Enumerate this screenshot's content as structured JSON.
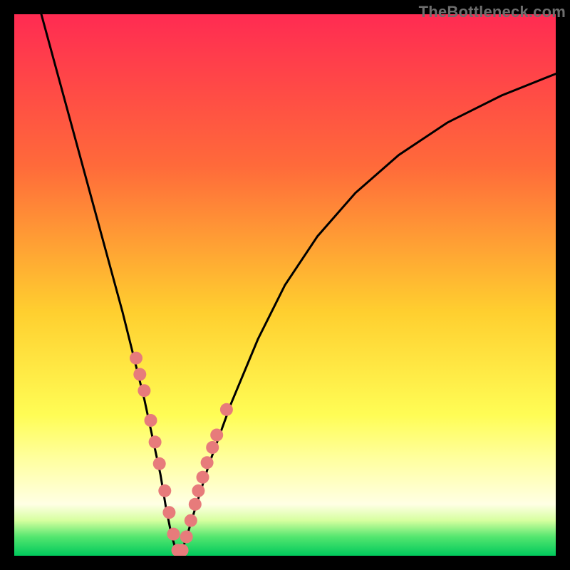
{
  "watermark": "TheBottleneck.com",
  "colors": {
    "bg_black": "#000000",
    "curve": "#000000",
    "marker_fill": "#e77b7b",
    "gradient_stops": [
      {
        "offset": 0.0,
        "color": "#ff2b52"
      },
      {
        "offset": 0.28,
        "color": "#ff6a3a"
      },
      {
        "offset": 0.55,
        "color": "#ffcf2f"
      },
      {
        "offset": 0.74,
        "color": "#fffd55"
      },
      {
        "offset": 0.82,
        "color": "#ffff9e"
      },
      {
        "offset": 0.905,
        "color": "#ffffe4"
      },
      {
        "offset": 0.935,
        "color": "#d6ff9f"
      },
      {
        "offset": 0.965,
        "color": "#54e66f"
      },
      {
        "offset": 1.0,
        "color": "#00c95c"
      }
    ]
  },
  "chart_data": {
    "type": "line",
    "title": "",
    "xlabel": "",
    "ylabel": "",
    "xlim": [
      0,
      100
    ],
    "ylim": [
      0,
      100
    ],
    "series": [
      {
        "name": "bottleneck-curve",
        "x": [
          5,
          8,
          11,
          14,
          17,
          20,
          22,
          24,
          25.5,
          27,
          28,
          29,
          30,
          31,
          32,
          33.5,
          36,
          40,
          45,
          50,
          56,
          63,
          71,
          80,
          90,
          100
        ],
        "y": [
          100,
          89,
          78,
          67,
          56,
          45,
          37,
          29,
          22,
          15,
          9,
          4,
          0.5,
          1,
          4,
          9,
          17,
          28,
          40,
          50,
          59,
          67,
          74,
          80,
          85,
          89
        ]
      }
    ],
    "markers": {
      "name": "highlight-points",
      "x": [
        22.5,
        23.2,
        24.0,
        25.2,
        26.0,
        26.8,
        27.8,
        28.6,
        29.4,
        30.2,
        31.0,
        31.8,
        32.6,
        33.4,
        34.0,
        34.8,
        35.6,
        36.6,
        37.4,
        39.2
      ],
      "y": [
        36.5,
        33.5,
        30.5,
        25.0,
        21.0,
        17.0,
        12.0,
        8.0,
        4.0,
        1.0,
        1.0,
        3.5,
        6.5,
        9.5,
        12.0,
        14.5,
        17.2,
        20.0,
        22.3,
        27.0
      ]
    }
  }
}
